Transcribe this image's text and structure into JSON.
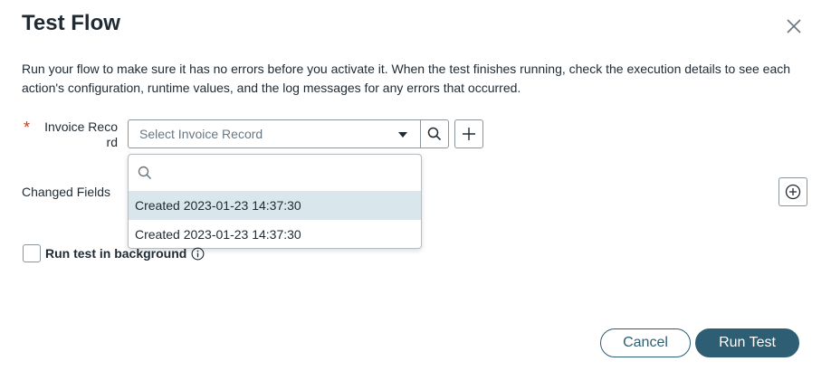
{
  "dialog": {
    "title": "Test Flow",
    "description": "Run your flow to make sure it has no errors before you activate it. When the test finishes running, check the execution details to see each action's configuration, runtime values, and the log messages for any errors that occurred."
  },
  "form": {
    "required_marker": "*",
    "invoice_label": "Invoice Reco rd",
    "invoice_placeholder": "Select Invoice Record",
    "changed_fields_label": "Changed Fields"
  },
  "dropdown": {
    "search_placeholder": "",
    "options": [
      {
        "label": "Created 2023-01-23 14:37:30",
        "highlighted": true
      },
      {
        "label": "Created 2023-01-23 14:37:30",
        "highlighted": false
      }
    ]
  },
  "background_option": {
    "label": "Run test in background",
    "checked": false
  },
  "footer": {
    "cancel_label": "Cancel",
    "run_label": "Run Test"
  },
  "colors": {
    "primary": "#2e5e73",
    "required": "#c4411f",
    "highlight": "#d9e6ec"
  },
  "icons": [
    "close-icon",
    "caret-down-icon",
    "search-icon",
    "plus-icon",
    "add-circle-icon",
    "info-icon"
  ]
}
